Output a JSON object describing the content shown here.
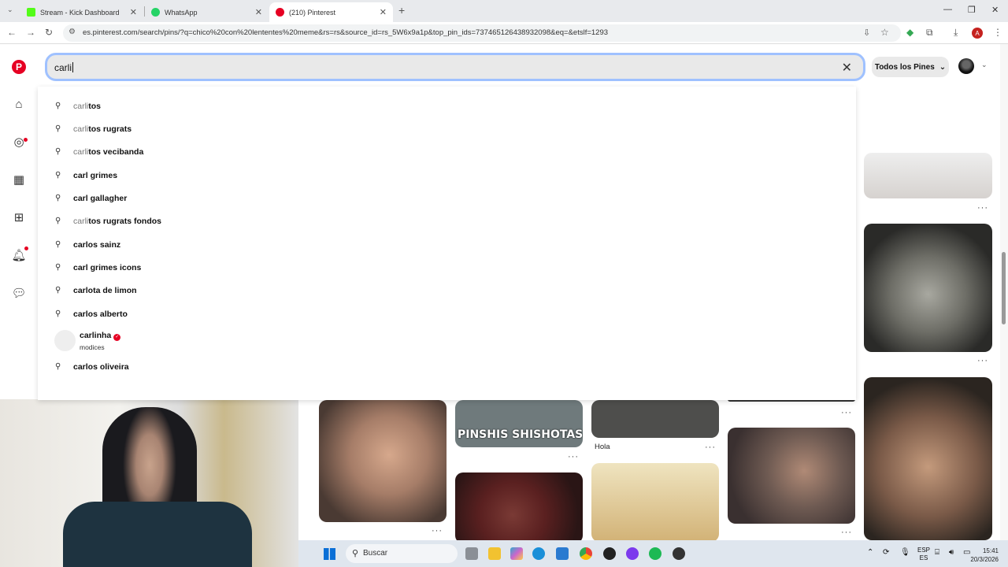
{
  "browser": {
    "tabs": [
      {
        "title": "Stream - Kick Dashboard",
        "color": "#53fc18"
      },
      {
        "title": "WhatsApp",
        "color": "#25d366"
      },
      {
        "title": "(210) Pinterest",
        "color": "#e60023"
      }
    ],
    "url": "es.pinterest.com/search/pins/?q=chico%20con%20lententes%20meme&rs=rs&source_id=rs_5W6x9a1p&top_pin_ids=737465126438932098&eq=&etslf=1293",
    "profile_initial": "A"
  },
  "search": {
    "value": "carli",
    "filter_label": "Todos los Pines"
  },
  "suggestions": [
    {
      "prefix": "carli",
      "rest": "tos"
    },
    {
      "prefix": "carli",
      "rest": "tos rugrats"
    },
    {
      "prefix": "carli",
      "rest": "tos vecibanda"
    },
    {
      "prefix": "",
      "rest": "carl grimes"
    },
    {
      "prefix": "",
      "rest": "carl gallagher"
    },
    {
      "prefix": "carli",
      "rest": "tos rugrats fondos"
    },
    {
      "prefix": "",
      "rest": "carlos sainz"
    },
    {
      "prefix": "",
      "rest": "carl grimes icons"
    },
    {
      "prefix": "",
      "rest": "carlota de limon"
    },
    {
      "prefix": "",
      "rest": "carlos alberto"
    }
  ],
  "account_suggestion": {
    "name": "carlinha",
    "subtitle": "modices"
  },
  "last_suggestion": {
    "prefix": "",
    "rest": "carlos oliveira"
  },
  "pins": {
    "caption_hola": "Hola",
    "meme_text": "PINSHIS SHISHOTAS"
  },
  "taskbar": {
    "search_label": "Buscar",
    "lang_top": "ESP",
    "lang_bottom": "ES",
    "time": "15:41",
    "date": "20/3/2026"
  },
  "colors": {
    "brand": "#e60023",
    "focus": "#9fc1ff"
  }
}
